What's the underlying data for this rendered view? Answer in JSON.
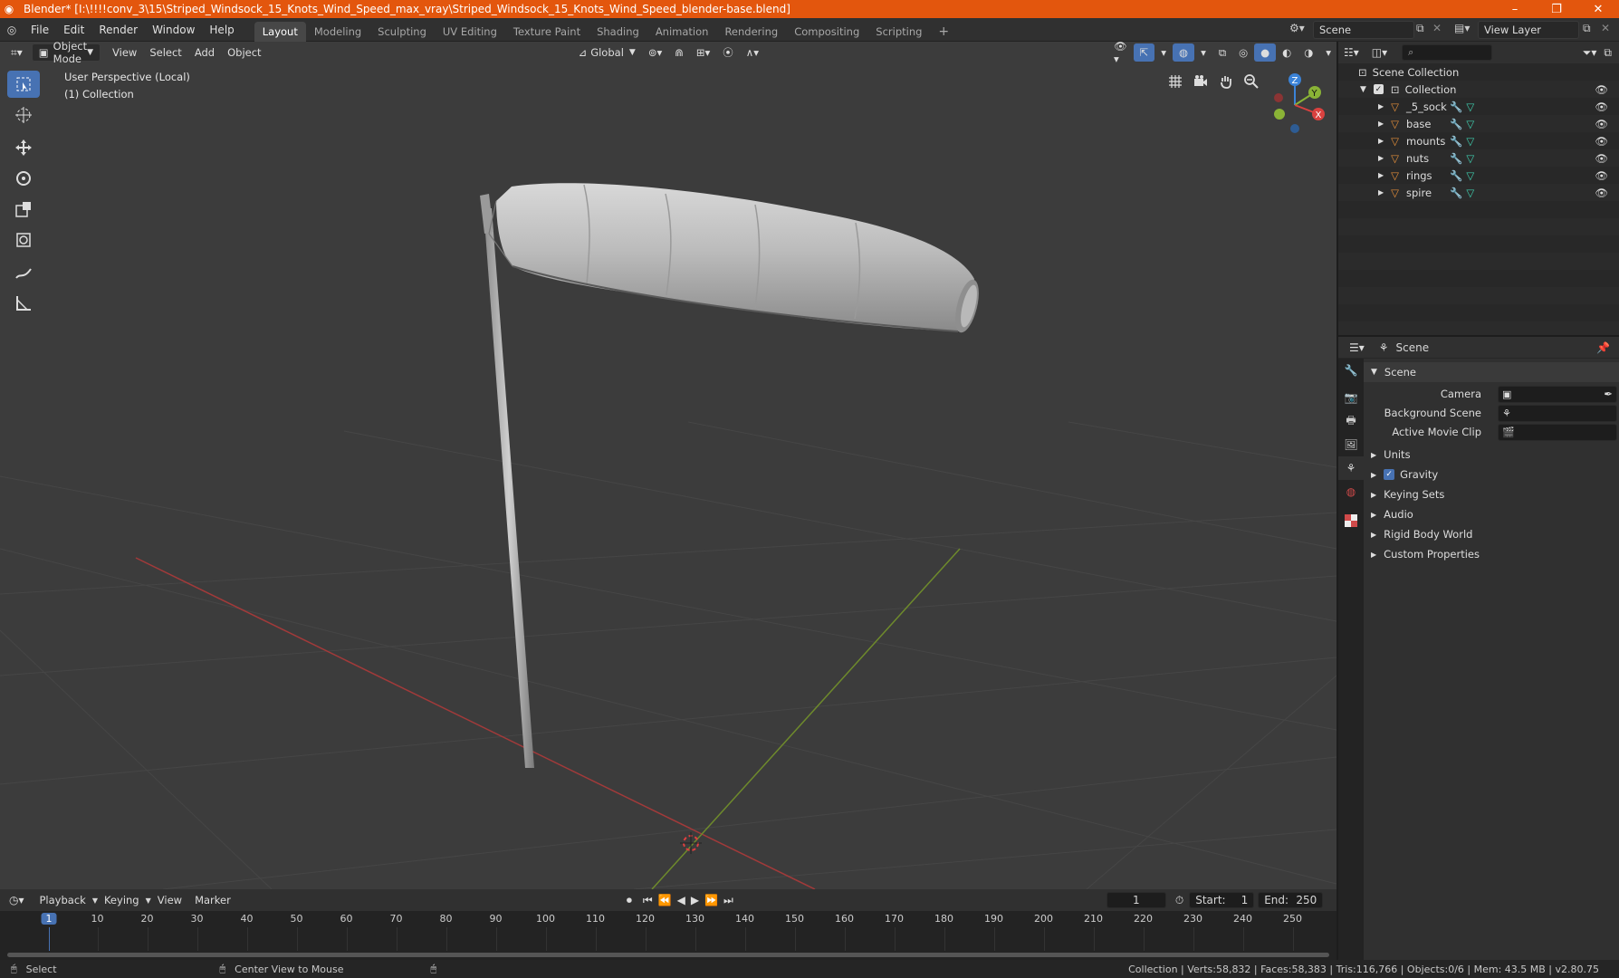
{
  "window": {
    "title": "Blender* [I:\\!!!!conv_3\\15\\Striped_Windsock_15_Knots_Wind_Speed_max_vray\\Striped_Windsock_15_Knots_Wind_Speed_blender-base.blend]",
    "minimize": "–",
    "maximize": "❐",
    "close": "✕"
  },
  "menu": [
    "File",
    "Edit",
    "Render",
    "Window",
    "Help"
  ],
  "workspaces": [
    "Layout",
    "Modeling",
    "Sculpting",
    "UV Editing",
    "Texture Paint",
    "Shading",
    "Animation",
    "Rendering",
    "Compositing",
    "Scripting"
  ],
  "workspace_add": "+",
  "scene_name": "Scene",
  "view_layer": "View Layer",
  "viewport": {
    "mode": "Object Mode",
    "menus": [
      "View",
      "Select",
      "Add",
      "Object"
    ],
    "orientation": "Global",
    "perspective_label": "User Perspective (Local)",
    "collection_label": "(1) Collection",
    "gizmo": {
      "x": "X",
      "y": "Y",
      "z": "Z"
    }
  },
  "outliner": {
    "root": "Scene Collection",
    "collection": "Collection",
    "objects": [
      "_5_sock",
      "base",
      "mounts",
      "nuts",
      "rings",
      "spire"
    ]
  },
  "properties": {
    "context": "Scene",
    "panel_title": "Scene",
    "camera_label": "Camera",
    "background_scene_label": "Background Scene",
    "active_movie_clip_label": "Active Movie Clip",
    "subpanels": [
      "Units",
      "Gravity",
      "Keying Sets",
      "Audio",
      "Rigid Body World",
      "Custom Properties"
    ],
    "gravity_checked": true
  },
  "timeline": {
    "menus": [
      "Playback",
      "Keying",
      "View",
      "Marker"
    ],
    "current_frame": "1",
    "start_label": "Start:",
    "start": "1",
    "end_label": "End:",
    "end": "250",
    "ticks": [
      "1",
      "10",
      "20",
      "30",
      "40",
      "50",
      "60",
      "70",
      "80",
      "90",
      "100",
      "110",
      "120",
      "130",
      "140",
      "150",
      "160",
      "170",
      "180",
      "190",
      "200",
      "210",
      "220",
      "230",
      "240",
      "250"
    ]
  },
  "status": {
    "select": "Select",
    "center_view": "Center View to Mouse",
    "stats": "Collection | Verts:58,832 | Faces:58,383 | Tris:116,766 | Objects:0/6 | Mem: 43.5 MB | v2.80.75"
  },
  "colors": {
    "accent": "#4772b3",
    "title_bar": "#e3560d",
    "x_axis": "#d9413f",
    "y_axis": "#8ab336",
    "z_axis": "#3b83d8"
  }
}
